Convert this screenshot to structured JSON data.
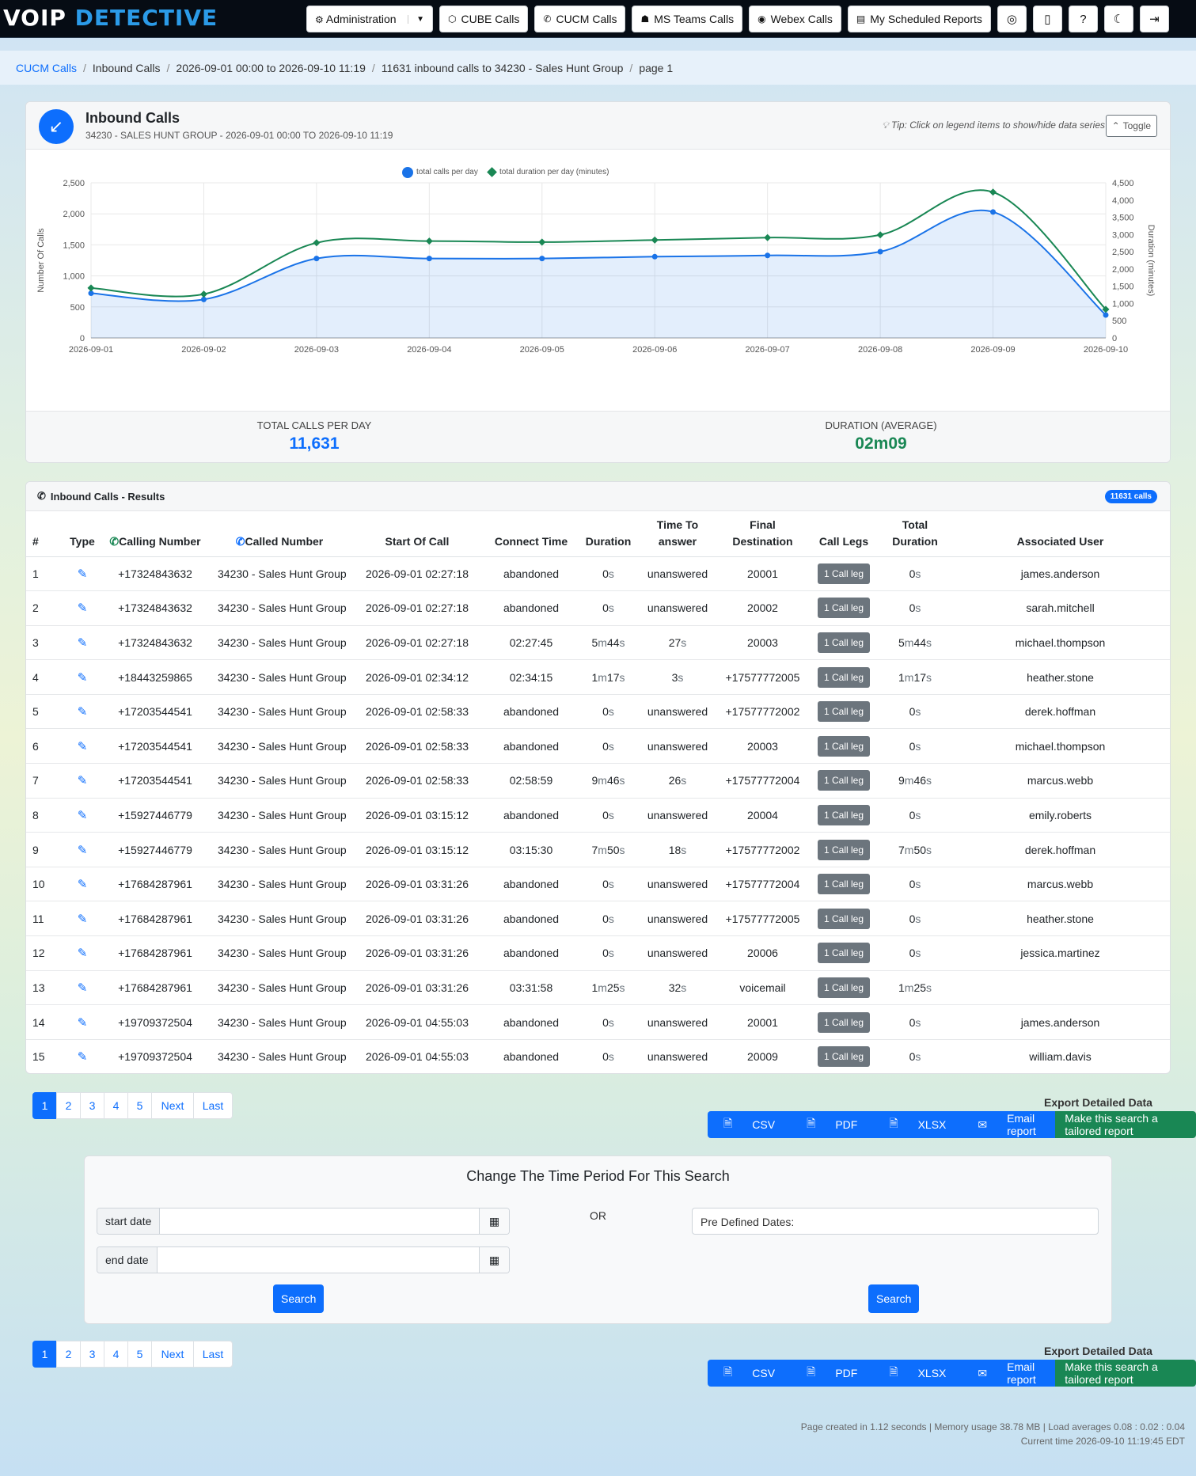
{
  "app": {
    "logo_a": "VOIP",
    "logo_b": "DETECTIVE"
  },
  "nav": {
    "admin": "Administration",
    "cube": "CUBE Calls",
    "cucm": "CUCM Calls",
    "teams": "MS Teams Calls",
    "webex": "Webex Calls",
    "reports": "My Scheduled Reports"
  },
  "breadcrumb": {
    "root": "CUCM Calls",
    "b1": "Inbound Calls",
    "b2": "2026-09-01 00:00 to 2026-09-10 11:19",
    "b3": "11631 inbound calls to 34230 - Sales Hunt Group",
    "b4": "page 1"
  },
  "chart_card": {
    "title": "Inbound Calls",
    "subtitle": "34230 - SALES HUNT GROUP - 2026-09-01 00:00 TO 2026-09-10 11:19",
    "tip": "Tip: Click on legend items to show/hide data series",
    "toggle": "Toggle",
    "total_label": "TOTAL CALLS PER DAY",
    "total_value": "11,631",
    "avg_label": "DURATION (AVERAGE)",
    "avg_value": "02m09"
  },
  "chart_data": {
    "type": "line",
    "x": [
      "2026-09-01",
      "2026-09-02",
      "2026-09-03",
      "2026-09-04",
      "2026-09-05",
      "2026-09-06",
      "2026-09-07",
      "2026-09-08",
      "2026-09-09",
      "2026-09-10"
    ],
    "ylabel": "Number Of Calls",
    "y2label": "Duration (minutes)",
    "ylim": [
      0,
      2500
    ],
    "y2lim": [
      0,
      4500
    ],
    "yticks": [
      "0",
      "500",
      "1,000",
      "1,500",
      "2,000",
      "2,500"
    ],
    "y2ticks": [
      "0",
      "500",
      "1,000",
      "1,500",
      "2,000",
      "2,500",
      "3,000",
      "3,500",
      "4,000",
      "4,500"
    ],
    "series": [
      {
        "name": "total calls per day",
        "axis": "left",
        "color": "#1a73e8",
        "values": [
          720,
          620,
          1280,
          1280,
          1280,
          1310,
          1330,
          1390,
          2030,
          370
        ]
      },
      {
        "name": "total duration per day (minutes)",
        "axis": "right",
        "color": "#198754",
        "values": [
          1450,
          1270,
          2760,
          2810,
          2780,
          2840,
          2910,
          2990,
          4230,
          830
        ]
      }
    ]
  },
  "results": {
    "title": "Inbound Calls - Results",
    "badge": "11631 calls",
    "headers": {
      "num": "#",
      "type": "Type",
      "calling": "Calling Number",
      "called": "Called Number",
      "start": "Start Of Call",
      "connect": "Connect Time",
      "duration": "Duration",
      "tta": "Time To answer",
      "final": "Final Destination",
      "legs": "Call Legs",
      "total": "Total Duration",
      "user": "Associated User"
    },
    "rows": [
      {
        "n": "1",
        "calling": "+17324843632",
        "called": "34230 - Sales Hunt Group",
        "start": "2026-09-01 02:27:18",
        "connect": "abandoned",
        "duration": "0s",
        "tta": "unanswered",
        "final": "20001",
        "legs": "1 Call leg",
        "total": "0s",
        "user": "james.anderson"
      },
      {
        "n": "2",
        "calling": "+17324843632",
        "called": "34230 - Sales Hunt Group",
        "start": "2026-09-01 02:27:18",
        "connect": "abandoned",
        "duration": "0s",
        "tta": "unanswered",
        "final": "20002",
        "legs": "1 Call leg",
        "total": "0s",
        "user": "sarah.mitchell"
      },
      {
        "n": "3",
        "calling": "+17324843632",
        "called": "34230 - Sales Hunt Group",
        "start": "2026-09-01 02:27:18",
        "connect": "02:27:45",
        "duration": "5m44s",
        "tta": "27s",
        "final": "20003",
        "legs": "1 Call leg",
        "total": "5m44s",
        "user": "michael.thompson"
      },
      {
        "n": "4",
        "calling": "+18443259865",
        "called": "34230 - Sales Hunt Group",
        "start": "2026-09-01 02:34:12",
        "connect": "02:34:15",
        "duration": "1m17s",
        "tta": "3s",
        "final": "+17577772005",
        "legs": "1 Call leg",
        "total": "1m17s",
        "user": "heather.stone"
      },
      {
        "n": "5",
        "calling": "+17203544541",
        "called": "34230 - Sales Hunt Group",
        "start": "2026-09-01 02:58:33",
        "connect": "abandoned",
        "duration": "0s",
        "tta": "unanswered",
        "final": "+17577772002",
        "legs": "1 Call leg",
        "total": "0s",
        "user": "derek.hoffman"
      },
      {
        "n": "6",
        "calling": "+17203544541",
        "called": "34230 - Sales Hunt Group",
        "start": "2026-09-01 02:58:33",
        "connect": "abandoned",
        "duration": "0s",
        "tta": "unanswered",
        "final": "20003",
        "legs": "1 Call leg",
        "total": "0s",
        "user": "michael.thompson"
      },
      {
        "n": "7",
        "calling": "+17203544541",
        "called": "34230 - Sales Hunt Group",
        "start": "2026-09-01 02:58:33",
        "connect": "02:58:59",
        "duration": "9m46s",
        "tta": "26s",
        "final": "+17577772004",
        "legs": "1 Call leg",
        "total": "9m46s",
        "user": "marcus.webb"
      },
      {
        "n": "8",
        "calling": "+15927446779",
        "called": "34230 - Sales Hunt Group",
        "start": "2026-09-01 03:15:12",
        "connect": "abandoned",
        "duration": "0s",
        "tta": "unanswered",
        "final": "20004",
        "legs": "1 Call leg",
        "total": "0s",
        "user": "emily.roberts"
      },
      {
        "n": "9",
        "calling": "+15927446779",
        "called": "34230 - Sales Hunt Group",
        "start": "2026-09-01 03:15:12",
        "connect": "03:15:30",
        "duration": "7m50s",
        "tta": "18s",
        "final": "+17577772002",
        "legs": "1 Call leg",
        "total": "7m50s",
        "user": "derek.hoffman"
      },
      {
        "n": "10",
        "calling": "+17684287961",
        "called": "34230 - Sales Hunt Group",
        "start": "2026-09-01 03:31:26",
        "connect": "abandoned",
        "duration": "0s",
        "tta": "unanswered",
        "final": "+17577772004",
        "legs": "1 Call leg",
        "total": "0s",
        "user": "marcus.webb"
      },
      {
        "n": "11",
        "calling": "+17684287961",
        "called": "34230 - Sales Hunt Group",
        "start": "2026-09-01 03:31:26",
        "connect": "abandoned",
        "duration": "0s",
        "tta": "unanswered",
        "final": "+17577772005",
        "legs": "1 Call leg",
        "total": "0s",
        "user": "heather.stone"
      },
      {
        "n": "12",
        "calling": "+17684287961",
        "called": "34230 - Sales Hunt Group",
        "start": "2026-09-01 03:31:26",
        "connect": "abandoned",
        "duration": "0s",
        "tta": "unanswered",
        "final": "20006",
        "legs": "1 Call leg",
        "total": "0s",
        "user": "jessica.martinez"
      },
      {
        "n": "13",
        "calling": "+17684287961",
        "called": "34230 - Sales Hunt Group",
        "start": "2026-09-01 03:31:26",
        "connect": "03:31:58",
        "duration": "1m25s",
        "tta": "32s",
        "final": "voicemail",
        "legs": "1 Call leg",
        "total": "1m25s",
        "user": ""
      },
      {
        "n": "14",
        "calling": "+19709372504",
        "called": "34230 - Sales Hunt Group",
        "start": "2026-09-01 04:55:03",
        "connect": "abandoned",
        "duration": "0s",
        "tta": "unanswered",
        "final": "20001",
        "legs": "1 Call leg",
        "total": "0s",
        "user": "james.anderson"
      },
      {
        "n": "15",
        "calling": "+19709372504",
        "called": "34230 - Sales Hunt Group",
        "start": "2026-09-01 04:55:03",
        "connect": "abandoned",
        "duration": "0s",
        "tta": "unanswered",
        "final": "20009",
        "legs": "1 Call leg",
        "total": "0s",
        "user": "william.davis"
      }
    ]
  },
  "pagination": {
    "pages": [
      "1",
      "2",
      "3",
      "4",
      "5"
    ],
    "next": "Next",
    "last": "Last",
    "current": "1"
  },
  "export": {
    "title": "Export Detailed Data",
    "csv": "CSV",
    "pdf": "PDF",
    "xlsx": "XLSX",
    "email": "Email report",
    "tailored": "Make this search a tailored report"
  },
  "date_form": {
    "title": "Change The Time Period For This Search",
    "start_label": "start date",
    "end_label": "end date",
    "or": "OR",
    "predefined": "Pre Defined Dates:",
    "search": "Search"
  },
  "footer": {
    "line1": "Page created in 1.12 seconds | Memory usage 38.78 MB | Load averages 0.08 : 0.02 : 0.04",
    "line2": "Current time 2026-09-10 11:19:45 EDT"
  }
}
